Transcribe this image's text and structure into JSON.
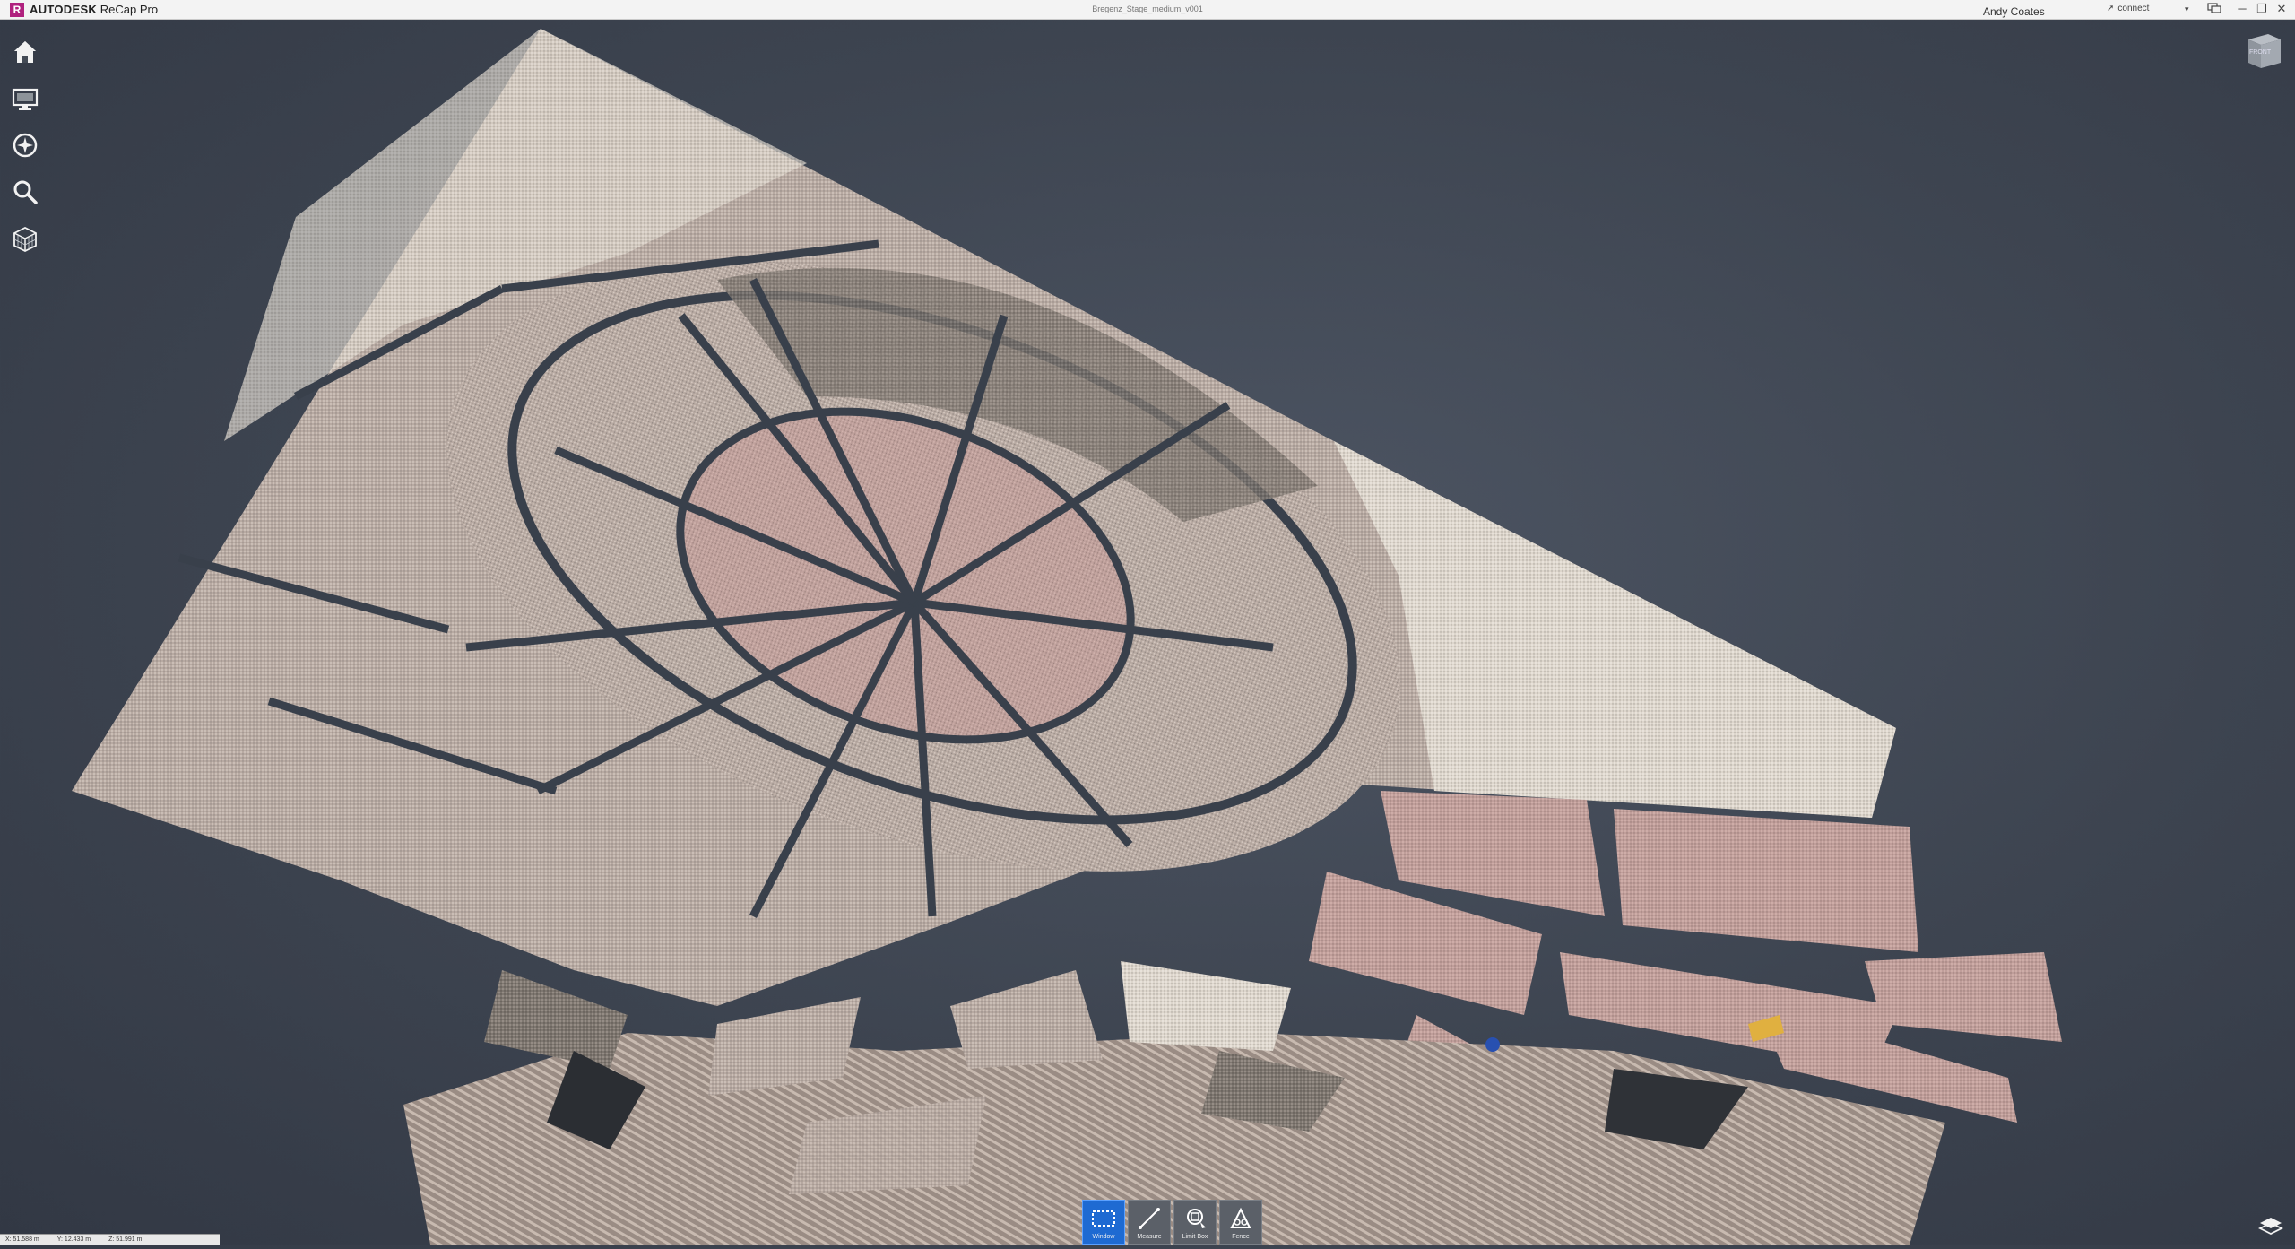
{
  "titlebar": {
    "logo_letter": "R",
    "brand": "AUTODESK",
    "product": "ReCap Pro",
    "document_title": "Bregenz_Stage_medium_v001",
    "user": "Andy Coates",
    "connect_label": "connect",
    "window_buttons": {
      "minimize": "─",
      "restore": "❐",
      "close": "✕"
    }
  },
  "left_toolbar": {
    "items": [
      {
        "name": "home-icon"
      },
      {
        "name": "display-settings-icon"
      },
      {
        "name": "navigation-icon"
      },
      {
        "name": "search-icon"
      },
      {
        "name": "region-cube-icon"
      }
    ]
  },
  "view_cube": {
    "label": "FRONT"
  },
  "bottom_toolbar": {
    "items": [
      {
        "label": "Window",
        "icon": "window-select-icon",
        "active": true
      },
      {
        "label": "Measure",
        "icon": "measure-icon",
        "active": false
      },
      {
        "label": "Limit Box",
        "icon": "limit-box-icon",
        "active": false
      },
      {
        "label": "Fence",
        "icon": "fence-icon",
        "active": false
      }
    ]
  },
  "status_bar": {
    "x": "X: 51.588 m",
    "y": "Y: 12.433 m",
    "z": "Z: 51.991 m"
  },
  "colors": {
    "accent": "#1e6ad2",
    "logo": "#b0217e",
    "background": "#3d4450"
  }
}
